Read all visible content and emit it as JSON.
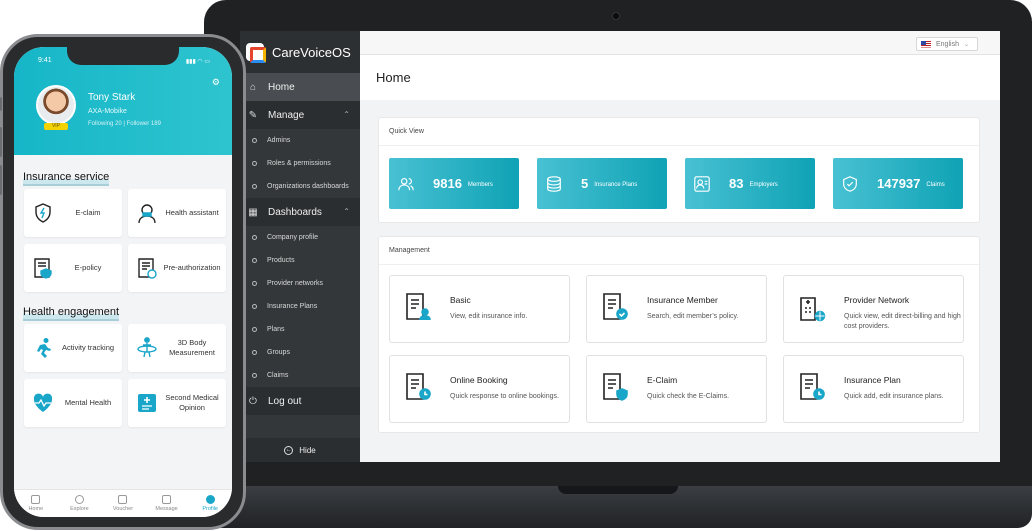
{
  "desktop": {
    "brand": "CareVoiceOS",
    "language": "English",
    "page_title": "Home",
    "sidebar": {
      "items": [
        {
          "label": "Home",
          "type": "main",
          "icon": "home-icon"
        },
        {
          "label": "Manage",
          "type": "section",
          "icon": "wrench-icon"
        },
        {
          "label": "Admins",
          "type": "sub"
        },
        {
          "label": "Roles & permissions",
          "type": "sub"
        },
        {
          "label": "Organizations dashboards",
          "type": "sub"
        },
        {
          "label": "Dashboards",
          "type": "section",
          "icon": "dashboard-icon"
        },
        {
          "label": "Company profile",
          "type": "sub"
        },
        {
          "label": "Products",
          "type": "sub"
        },
        {
          "label": "Provider networks",
          "type": "sub"
        },
        {
          "label": "Insurance Plans",
          "type": "sub"
        },
        {
          "label": "Plans",
          "type": "sub"
        },
        {
          "label": "Groups",
          "type": "sub"
        },
        {
          "label": "Claims",
          "type": "sub"
        },
        {
          "label": "Log out",
          "type": "section",
          "icon": "power-icon"
        }
      ],
      "hide_label": "Hide"
    },
    "quick_view": {
      "title": "Quick View",
      "stats": [
        {
          "value": "9816",
          "label": "Members",
          "icon": "members-icon"
        },
        {
          "value": "5",
          "label": "Insurance Plans",
          "icon": "database-icon"
        },
        {
          "value": "83",
          "label": "Employers",
          "icon": "employer-icon"
        },
        {
          "value": "147937",
          "label": "Claims",
          "icon": "shield-check-icon"
        }
      ]
    },
    "management": {
      "title": "Management",
      "tiles": [
        {
          "title": "Basic",
          "desc": "View, edit insurance info.",
          "icon": "document-user-icon"
        },
        {
          "title": "Insurance Member",
          "desc": "Search, edit member’s policy.",
          "icon": "document-check-icon"
        },
        {
          "title": "Provider Network",
          "desc": "Quick view, edit direct-billing and high cost providers.",
          "icon": "hospital-network-icon"
        },
        {
          "title": "Online Booking",
          "desc": "Quick response to online bookings.",
          "icon": "document-clock-icon"
        },
        {
          "title": "E-Claim",
          "desc": "Quick check the E-Claims.",
          "icon": "document-shield-icon"
        },
        {
          "title": "Insurance Plan",
          "desc": "Quick add, edit insurance plans.",
          "icon": "document-clock-icon"
        }
      ]
    }
  },
  "phone": {
    "time": "9:41",
    "user": {
      "name": "Tony Stark",
      "company": "AXA-Mobike",
      "follow": "Following 20   |   Follower 189",
      "badge": "VIP"
    },
    "insurance_service": {
      "title": "Insurance service",
      "tiles": [
        {
          "label": "E-claim",
          "icon": "shield-bolt-icon"
        },
        {
          "label": "Health assistant",
          "icon": "nurse-icon"
        },
        {
          "label": "E-policy",
          "icon": "policy-icon"
        },
        {
          "label": "Pre-authorization",
          "icon": "preauth-icon"
        }
      ]
    },
    "health_engagement": {
      "title": "Health engagement",
      "tiles": [
        {
          "label": "Activity tracking",
          "icon": "running-icon"
        },
        {
          "label": "3D Body Measurement",
          "icon": "body-measure-icon"
        },
        {
          "label": "Mental Health",
          "icon": "heart-pulse-icon"
        },
        {
          "label": "Second Medical Opinion",
          "icon": "medical-opinion-icon"
        }
      ]
    },
    "tabs": [
      {
        "label": "Home",
        "active": false
      },
      {
        "label": "Explore",
        "active": false
      },
      {
        "label": "Voucher",
        "active": false
      },
      {
        "label": "Message",
        "active": false
      },
      {
        "label": "Profile",
        "active": true
      }
    ]
  },
  "colors": {
    "accent": "#1aa6c9",
    "stat_gradient": "#48c1d3",
    "sidebar": "#34373a"
  }
}
